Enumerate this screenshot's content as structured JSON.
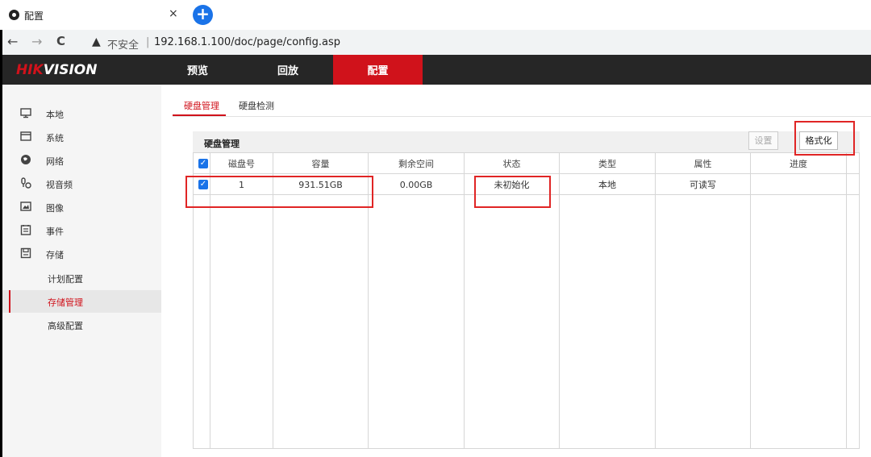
{
  "browser": {
    "tab_title": "配置",
    "close_glyph": "×",
    "new_tab_glyph": "+",
    "nav": {
      "back": "←",
      "forward": "→",
      "reload": "C"
    },
    "security_warning": "不安全",
    "address_divider": "|",
    "url": "192.168.1.100/doc/page/config.asp"
  },
  "app": {
    "logo": {
      "part1": "HIK",
      "part2": "VISION"
    },
    "topnav": [
      {
        "label": "预览"
      },
      {
        "label": "回放"
      },
      {
        "label": "配置",
        "active": true
      }
    ]
  },
  "sidebar": {
    "items": [
      {
        "label": "本地",
        "icon": "monitor-icon"
      },
      {
        "label": "系统",
        "icon": "window-icon"
      },
      {
        "label": "网络",
        "icon": "globe-icon"
      },
      {
        "label": "视音频",
        "icon": "mic-camera-icon"
      },
      {
        "label": "图像",
        "icon": "image-icon"
      },
      {
        "label": "事件",
        "icon": "calendar-icon"
      },
      {
        "label": "存储",
        "icon": "disk-icon"
      }
    ],
    "subitems": [
      {
        "label": "计划配置"
      },
      {
        "label": "存储管理",
        "active": true
      },
      {
        "label": "高级配置"
      }
    ]
  },
  "content": {
    "tabs": [
      {
        "label": "硬盘管理",
        "active": true
      },
      {
        "label": "硬盘检测"
      }
    ],
    "panel_title": "硬盘管理",
    "buttons": {
      "set": "设置",
      "format": "格式化"
    },
    "table": {
      "headers": [
        "磁盘号",
        "容量",
        "剩余空间",
        "状态",
        "类型",
        "属性",
        "进度"
      ],
      "rows": [
        {
          "disk_no": "1",
          "capacity": "931.51GB",
          "free": "0.00GB",
          "status": "未初始化",
          "type": "本地",
          "attr": "可读写",
          "progress": "",
          "checked": true
        }
      ]
    }
  },
  "colors": {
    "brand_red": "#d0121b",
    "header_bg": "#262626",
    "highlight": "#e02525",
    "checkbox": "#1a73e8"
  }
}
